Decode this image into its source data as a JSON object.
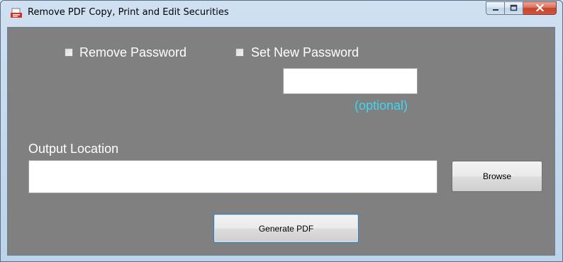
{
  "window": {
    "title": "Remove PDF Copy, Print and Edit Securities",
    "icon": "pdf-app-icon"
  },
  "options": {
    "remove_password_label": "Remove Password",
    "remove_password_checked": false,
    "set_new_password_label": "Set New Password",
    "set_new_password_checked": false,
    "new_password_value": "",
    "optional_hint": "(optional)",
    "optional_hint_color": "#3ad8f0"
  },
  "output": {
    "label": "Output Location",
    "path_value": "",
    "browse_label": "Browse"
  },
  "actions": {
    "generate_label": "Generate PDF"
  },
  "colors": {
    "client_background": "#808080",
    "close_button": "#c7432b"
  }
}
